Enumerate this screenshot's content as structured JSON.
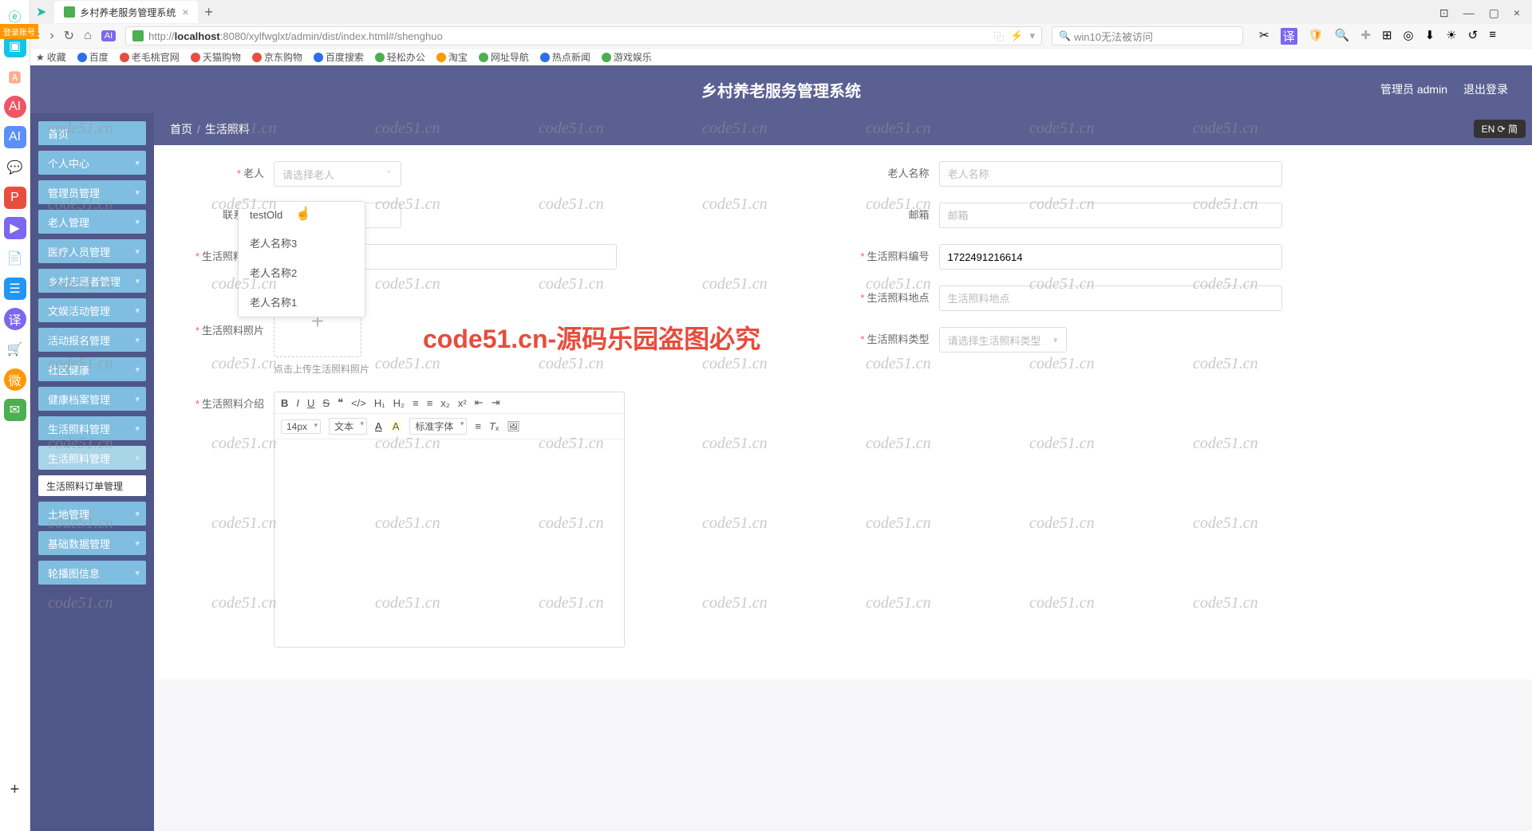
{
  "browser": {
    "tab_title": "乡村养老服务管理系统",
    "url_prefix": "http://",
    "url_host": "localhost",
    "url_path": ":8080/xylfwglxt/admin/dist/index.html#/shenghuo",
    "search_placeholder": "win10无法被访问",
    "login_badge": "登录账号"
  },
  "bookmarks": [
    "收藏",
    "百度",
    "老毛桃官网",
    "天猫购物",
    "京东购物",
    "百度搜索",
    "轻松办公",
    "淘宝",
    "网址导航",
    "热点新闻",
    "游戏娱乐"
  ],
  "app": {
    "title": "乡村养老服务管理系统",
    "user_label": "管理员 admin",
    "logout": "退出登录",
    "lang_badge": "EN ⟳ 简"
  },
  "menu": [
    {
      "label": "首页",
      "chevron": false
    },
    {
      "label": "个人中心",
      "chevron": true
    },
    {
      "label": "管理员管理",
      "chevron": true
    },
    {
      "label": "老人管理",
      "chevron": true
    },
    {
      "label": "医疗人员管理",
      "chevron": true
    },
    {
      "label": "乡村志愿者管理",
      "chevron": true
    },
    {
      "label": "文娱活动管理",
      "chevron": true
    },
    {
      "label": "活动报名管理",
      "chevron": true
    },
    {
      "label": "社区健康",
      "chevron": true
    },
    {
      "label": "健康档案管理",
      "chevron": true
    },
    {
      "label": "生活照料管理",
      "chevron": true
    },
    {
      "label": "生活照料管理",
      "chevron": true,
      "active": true
    }
  ],
  "submenu_label": "生活照料订单管理",
  "menu_tail": [
    {
      "label": "土地管理",
      "chevron": true
    },
    {
      "label": "基础数据管理",
      "chevron": true
    },
    {
      "label": "轮播图信息",
      "chevron": true
    }
  ],
  "breadcrumb": {
    "home": "首页",
    "current": "生活照料"
  },
  "form": {
    "elder_label": "老人",
    "elder_placeholder": "请选择老人",
    "elder_name_label": "老人名称",
    "elder_name_placeholder": "老人名称",
    "contact_label": "联系方式",
    "email_label": "邮箱",
    "email_placeholder": "邮箱",
    "care_name_label": "生活照料名称",
    "care_code_label": "生活照料编号",
    "care_code_value": "1722491216614",
    "care_photo_label": "生活照料照片",
    "upload_hint": "点击上传生活照料照片",
    "care_place_label": "生活照料地点",
    "care_place_placeholder": "生活照料地点",
    "care_type_label": "生活照料类型",
    "care_type_placeholder": "请选择生活照料类型",
    "care_intro_label": "生活照料介绍"
  },
  "dropdown_options": [
    "testOld",
    "老人名称3",
    "老人名称2",
    "老人名称1"
  ],
  "editor_toolbar": {
    "font_size": "14px",
    "text_type": "文本",
    "font_family": "标准字体"
  },
  "watermark_text": "code51.cn",
  "watermark_red": "code51.cn-源码乐园盗图必究"
}
